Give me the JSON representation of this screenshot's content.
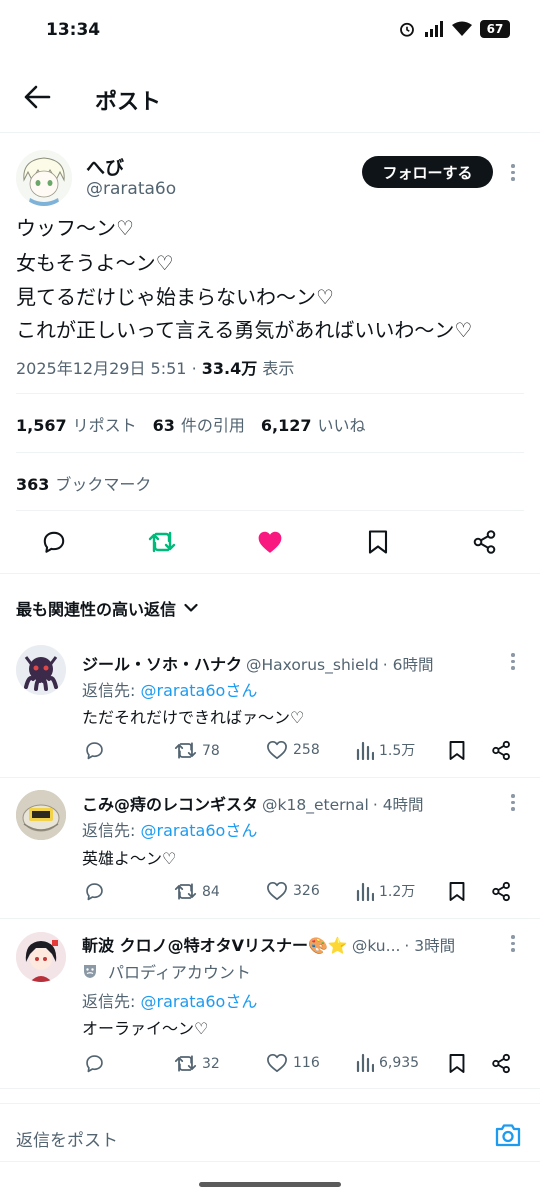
{
  "status_bar": {
    "time": "13:34",
    "battery": "67"
  },
  "header": {
    "title": "ポスト"
  },
  "main_tweet": {
    "author_name": "へび",
    "author_handle": "@rarata6o",
    "follow_label": "フォローする",
    "lines": [
      "ウッフ〜ン♡",
      "女もそうよ〜ン♡",
      "見てるだけじゃ始まらないわ〜ン♡",
      "これが正しいって言える勇気があればいいわ〜ン♡"
    ],
    "date": "2025年12月29日 5:51",
    "separator": "·",
    "views": "33.4万",
    "views_label": "表示",
    "reposts": "1,567",
    "reposts_label": "リポスト",
    "quotes": "63",
    "quotes_label": "件の引用",
    "likes": "6,127",
    "likes_label": "いいね",
    "bookmarks": "363",
    "bookmarks_label": "ブックマーク",
    "liked": true,
    "accent_repost": "#00ba7c",
    "accent_like": "#f91880"
  },
  "sort": {
    "label": "最も関連性の高い返信"
  },
  "replies": [
    {
      "name": "ジール・ソホ・ハナク",
      "handle": "@Haxorus_shield",
      "time": "· 6時間",
      "reply_to_prefix": "返信先:",
      "reply_to": "@rarata6oさん",
      "text": "ただそれだけできればァ〜ン♡",
      "reposts": "78",
      "likes": "258",
      "views": "1.5万"
    },
    {
      "name": "こみ@痔のレコンギスタ",
      "handle": "@k18_eternal",
      "time": "· 4時間",
      "reply_to_prefix": "返信先:",
      "reply_to": "@rarata6oさん",
      "text": "英雄よ〜ン♡",
      "reposts": "84",
      "likes": "326",
      "views": "1.2万"
    },
    {
      "name": "斬波 クロノ@特オタVリスナー🎨⭐",
      "handle": "@ku...",
      "time": "· 3時間",
      "parody_label": "パロディアカウント",
      "reply_to_prefix": "返信先:",
      "reply_to": "@rarata6oさん",
      "text": "オーラァイ〜ン♡",
      "reposts": "32",
      "likes": "116",
      "views": "6,935"
    }
  ],
  "compose": {
    "placeholder": "返信をポスト"
  },
  "link_color": "#1d9bf0"
}
